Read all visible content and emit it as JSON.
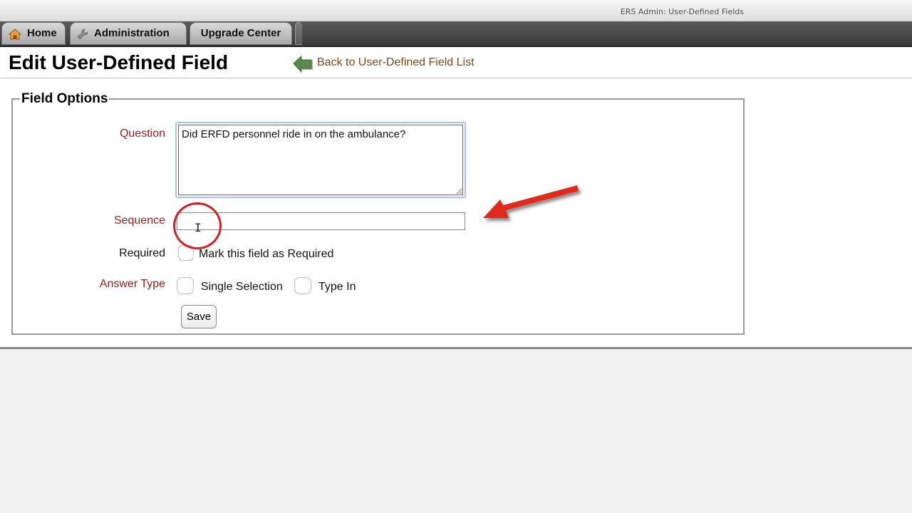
{
  "window": {
    "title": "ERS Admin: User-Defined Fields"
  },
  "nav": {
    "home": "Home",
    "administration": "Administration",
    "upgrade_center": "Upgrade Center"
  },
  "header": {
    "title": "Edit User-Defined Field",
    "back_link": "Back to User-Defined Field List"
  },
  "form": {
    "legend": "Field Options",
    "question_label": "Question",
    "question_value": "Did ERFD personnel ride in on the ambulance?",
    "sequence_label": "Sequence",
    "sequence_value": "",
    "required_label": "Required",
    "required_option": "Mark this field as Required",
    "answer_type_label": "Answer Type",
    "answer_types": [
      "Single Selection",
      "Type In"
    ],
    "save_label": "Save"
  },
  "icons": {
    "home": "home-icon",
    "administration": "wrench-icon",
    "back": "back-arrow-icon"
  },
  "colors": {
    "required_label": "#9a1a1a",
    "link": "#7a4a1a",
    "annotation": "#d02020"
  }
}
